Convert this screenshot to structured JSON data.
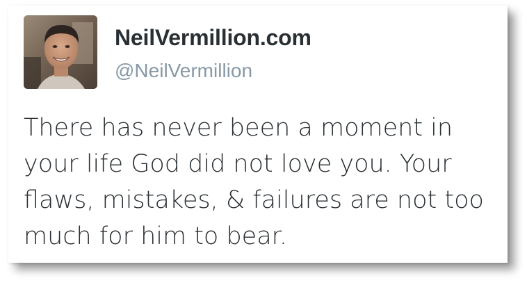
{
  "tweet": {
    "author": {
      "display_name": "NeilVermillion.com",
      "handle": "@NeilVermillion",
      "avatar_icon": "profile-photo"
    },
    "text_lines": [
      "There has never been a moment in",
      "your life God did not love you. Your",
      "flaws, mistakes, & failures are not too",
      "much for him to bear."
    ]
  },
  "colors": {
    "name_text": "#292f33",
    "handle_text": "#8899a6",
    "body_text": "#292f33",
    "card_background": "#ffffff"
  }
}
